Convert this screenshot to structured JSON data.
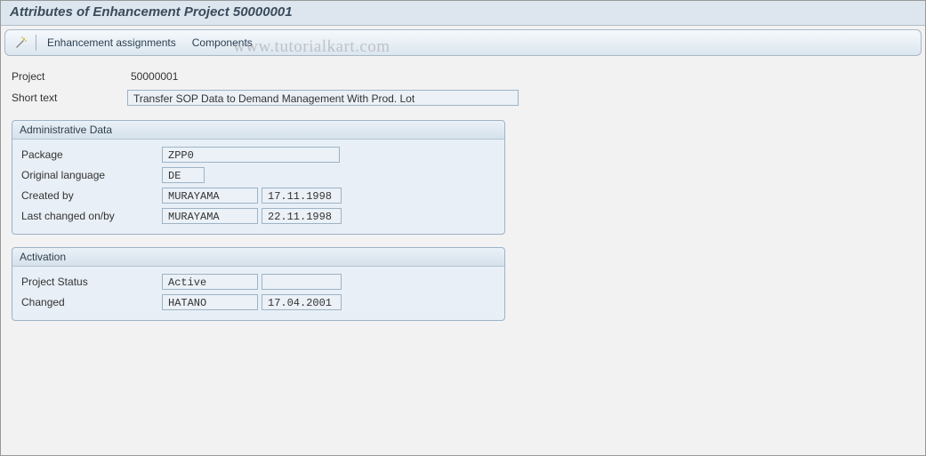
{
  "title": "Attributes of Enhancement Project 50000001",
  "toolbar": {
    "enhancement_assignments": "Enhancement assignments",
    "components": "Components"
  },
  "header": {
    "project_label": "Project",
    "project_value": "50000001",
    "short_text_label": "Short text",
    "short_text_value": "Transfer SOP Data to Demand Management With Prod. Lot"
  },
  "admin": {
    "title": "Administrative Data",
    "package_label": "Package",
    "package_value": "ZPP0",
    "orig_lang_label": "Original language",
    "orig_lang_value": "DE",
    "created_by_label": "Created by",
    "created_by_user": "MURAYAMA",
    "created_by_date": "17.11.1998",
    "last_changed_label": "Last changed on/by",
    "last_changed_user": "MURAYAMA",
    "last_changed_date": "22.11.1998"
  },
  "activation": {
    "title": "Activation",
    "status_label": "Project Status",
    "status_value": "Active",
    "status_extra": "",
    "changed_label": "Changed",
    "changed_user": "HATANO",
    "changed_date": "17.04.2001"
  },
  "watermark": "www.tutorialkart.com"
}
